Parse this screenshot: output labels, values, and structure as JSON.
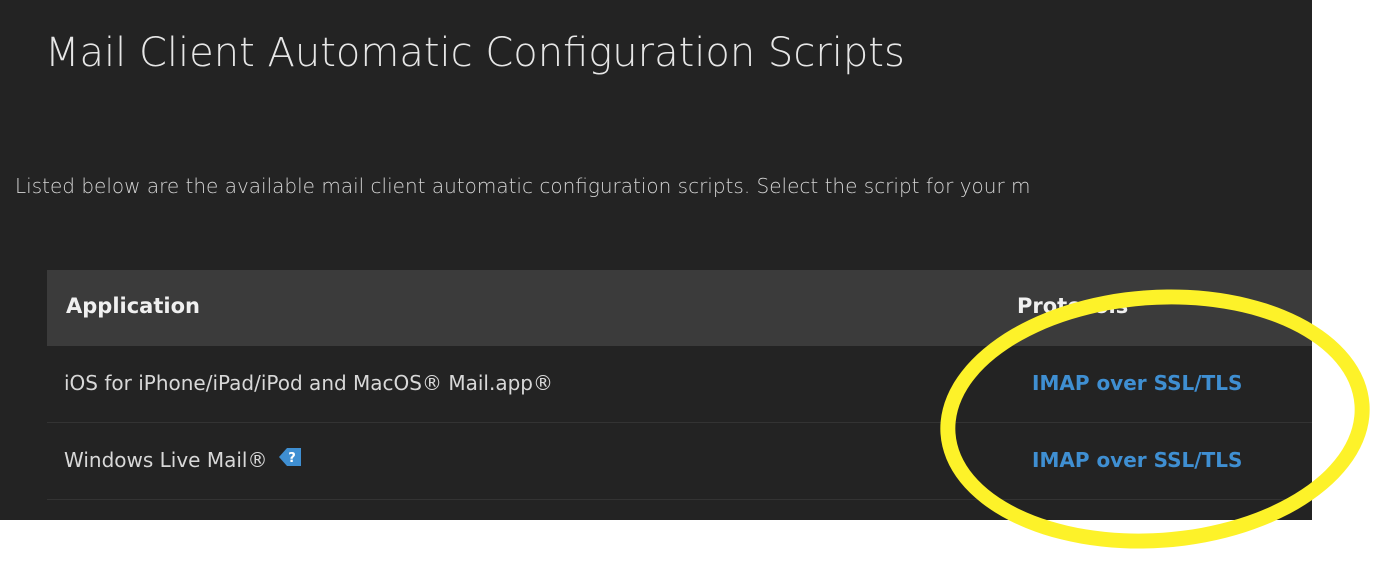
{
  "page": {
    "title": "Mail Client Automatic Configuration Scripts",
    "intro": "Listed below are the available mail client automatic configuration scripts. Select the script for your m"
  },
  "table": {
    "columns": [
      "Application",
      "Protocols"
    ],
    "rows": [
      {
        "application": "iOS for iPhone/iPad/iPod and MacOS® Mail.app®",
        "protocol": "IMAP over SSL/TLS"
      },
      {
        "application": "Windows Live Mail®",
        "protocol": "IMAP over SSL/TLS",
        "icon": "help-icon"
      }
    ]
  },
  "colors": {
    "background": "#232323",
    "header_row": "#3b3b3b",
    "link": "#3f8fd2",
    "annotation": "#fdf229"
  }
}
